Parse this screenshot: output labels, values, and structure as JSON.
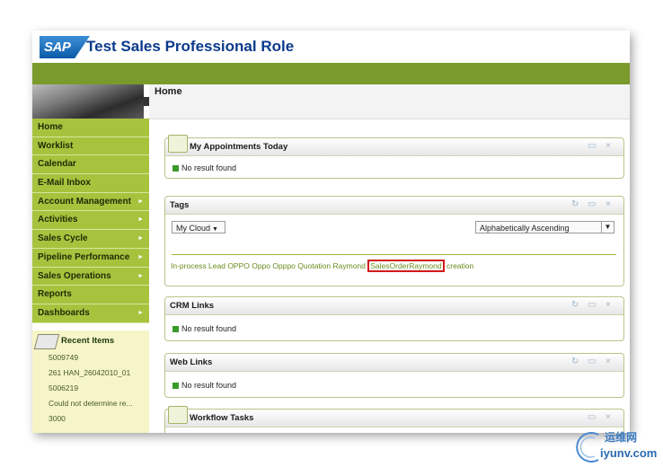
{
  "header": {
    "logo_text": "SAP",
    "title": "Test Sales Professional Role"
  },
  "page": {
    "title": "Home"
  },
  "nav": {
    "items": [
      {
        "label": "Home",
        "submenu": false
      },
      {
        "label": "Worklist",
        "submenu": false
      },
      {
        "label": "Calendar",
        "submenu": false
      },
      {
        "label": "E-Mail Inbox",
        "submenu": false
      },
      {
        "label": "Account Management",
        "submenu": true
      },
      {
        "label": "Activities",
        "submenu": true
      },
      {
        "label": "Sales Cycle",
        "submenu": true
      },
      {
        "label": "Pipeline Performance",
        "submenu": true
      },
      {
        "label": "Sales Operations",
        "submenu": true
      },
      {
        "label": "Reports",
        "submenu": false
      },
      {
        "label": "Dashboards",
        "submenu": true
      }
    ],
    "arrow_glyph": "►"
  },
  "recent": {
    "title": "Recent Items",
    "items": [
      "5009749",
      "261 HAN_26042010_01",
      "5006219",
      "Could not determine re...",
      "3000"
    ]
  },
  "panels": {
    "appointments": {
      "title": "My Appointments Today",
      "message": "No result found"
    },
    "tags": {
      "title": "Tags",
      "cloud_select": "My Cloud",
      "sort_select": "Alphabetically Ascending",
      "tags_before": "In-process Lead OPPO Oppo Opppo Quotation Raymond ",
      "tag_highlight": "SalesOrderRaymond",
      "tags_after": " creation"
    },
    "crm_links": {
      "title": "CRM Links",
      "message": "No result found"
    },
    "web_links": {
      "title": "Web Links",
      "message": "No result found"
    },
    "workflow": {
      "title": "Workflow Tasks"
    }
  },
  "controls": {
    "refresh": "↻",
    "minimize": "▭",
    "close": "×",
    "dropdown_arrow": "▼"
  },
  "watermark": {
    "line1": "运维网",
    "line2": "iyunv.com"
  },
  "colors": {
    "nav_green": "#a7c33e",
    "header_bar": "#7a9a2b",
    "title_blue": "#0b3a8c",
    "highlight_red": "#d01818"
  }
}
